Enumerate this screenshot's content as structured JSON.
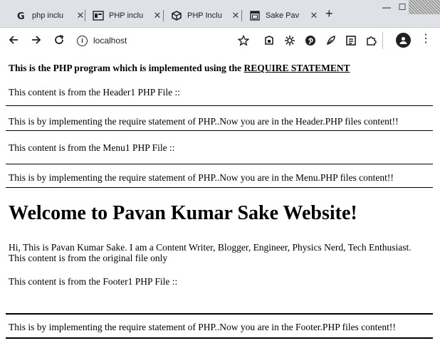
{
  "browser": {
    "tabs": [
      {
        "label": "php inclu",
        "icon": "google-icon"
      },
      {
        "label": "PHP inclu",
        "icon": "php-icon"
      },
      {
        "label": "PHP Inclu",
        "icon": "cube-icon"
      },
      {
        "label": "Sake Pav",
        "icon": "window-icon"
      }
    ],
    "new_tab": "+",
    "minimize": "—",
    "maximize": "☐",
    "close": "✕",
    "url": "localhost"
  },
  "page": {
    "intro_prefix": "This is the PHP program which is implemented using the",
    "intro_link": "REQUIRE STATEMENT",
    "header_content": "This content is from the Header1 PHP File ::",
    "header_msg": "This is by implementing the require statement of PHP..Now you are in the Header.PHP files content!!",
    "menu_content": "This content is from the Menu1 PHP File ::",
    "menu_msg": "This is by implementing the require statement of PHP..Now you are in the Menu.PHP files content!!",
    "heading": "Welcome to Pavan Kumar Sake Website!",
    "bio": "Hi, This is Pavan Kumar Sake. I am a Content Writer, Blogger, Engineer, Physics Nerd, Tech Enthusiast. This content is from the original file only",
    "footer_content": "This content is from the Footer1 PHP File ::",
    "footer_msg": "This is by implementing the require statement of PHP..Now you are in the Footer.PHP files content!!"
  }
}
